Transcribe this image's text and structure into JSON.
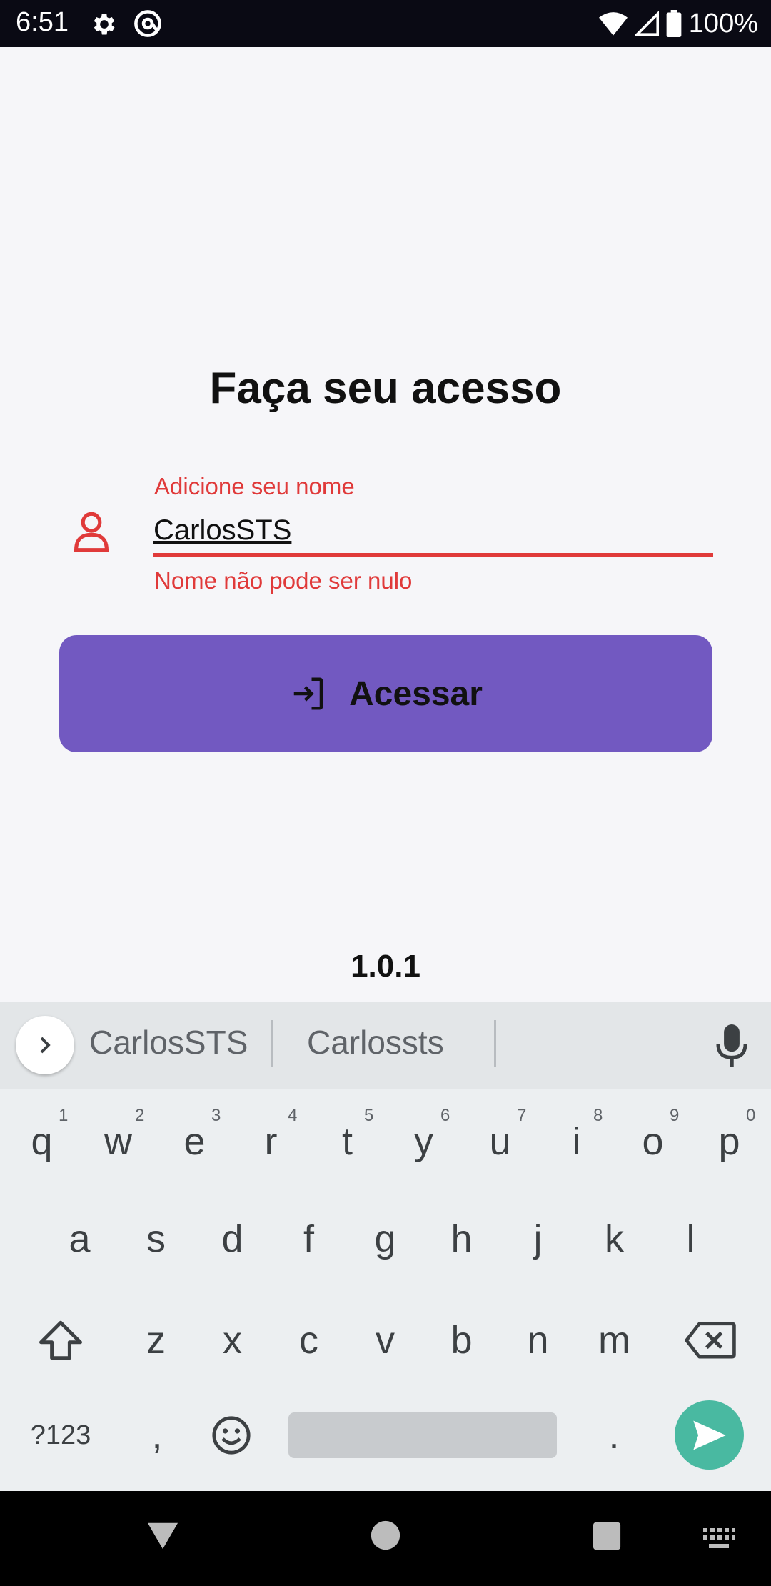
{
  "status_bar": {
    "time": "6:51",
    "battery": "100%",
    "icons": [
      "gear-icon",
      "at-sign-icon",
      "wifi-icon",
      "signal-icon",
      "battery-icon"
    ]
  },
  "login": {
    "title": "Faça seu acesso",
    "name_field": {
      "label": "Adicione seu nome",
      "value": "CarlosSTS",
      "error": "Nome não pode ser nulo"
    },
    "access_button_label": "Acessar",
    "version": "1.0.1"
  },
  "keyboard": {
    "suggestions": [
      "CarlosSTS",
      "Carlossts"
    ],
    "row1": [
      "q",
      "w",
      "e",
      "r",
      "t",
      "y",
      "u",
      "i",
      "o",
      "p"
    ],
    "row1_hints": [
      "1",
      "2",
      "3",
      "4",
      "5",
      "6",
      "7",
      "8",
      "9",
      "0"
    ],
    "row2": [
      "a",
      "s",
      "d",
      "f",
      "g",
      "h",
      "j",
      "k",
      "l"
    ],
    "row3": [
      "z",
      "x",
      "c",
      "v",
      "b",
      "n",
      "m"
    ],
    "symbols_label": "?123",
    "comma": ",",
    "period": "."
  },
  "colors": {
    "accent": "#7259c1",
    "error": "#e03a3a",
    "send": "#49b9a1"
  }
}
